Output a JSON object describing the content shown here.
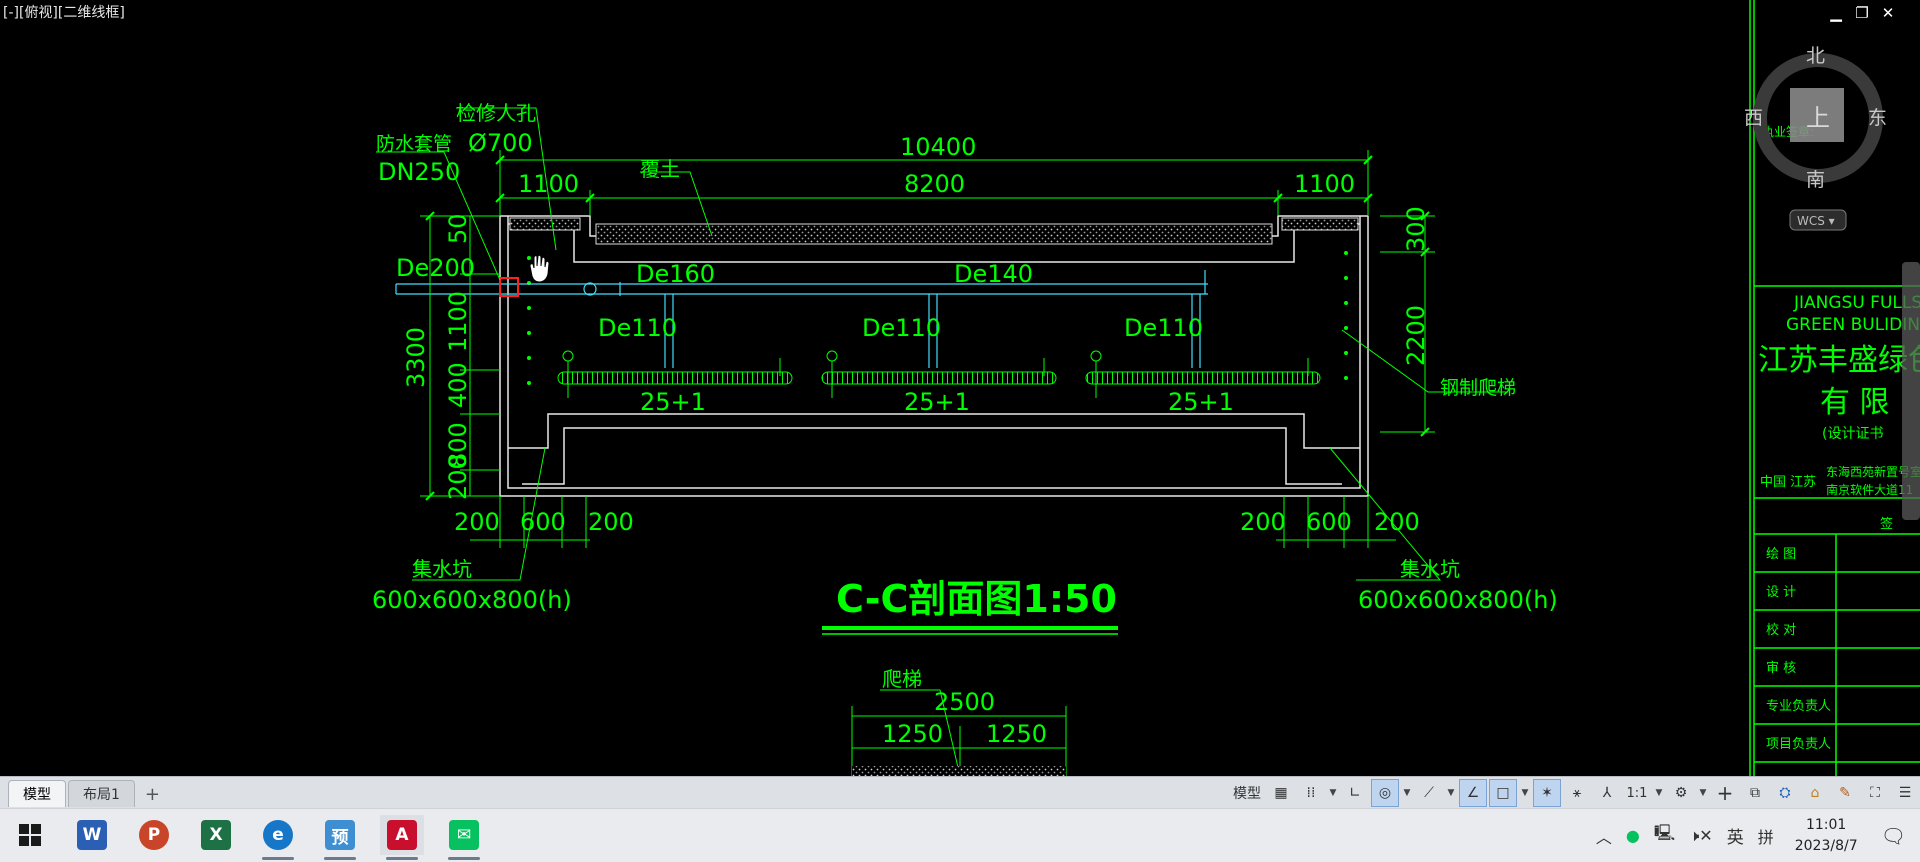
{
  "viewport": {
    "label": "[-][俯视][二维线框]",
    "window_controls": {
      "minimize": "▁",
      "restore": "❐",
      "close": "✕"
    },
    "viewcube": {
      "north": "北",
      "south": "南",
      "east": "东",
      "west": "西",
      "top": "上",
      "wcs": "WCS ▾"
    }
  },
  "drawing": {
    "section_title": "C-C剖面图1:50",
    "dimensions": {
      "overall": "10400",
      "middle": "8200",
      "left_end": "1100",
      "right_end": "1100",
      "h_total": "3300",
      "h_v1": "50",
      "h_v2": "300",
      "h_v3": "1100",
      "h_v4": "400",
      "h_v5": "800",
      "h_v6": "200",
      "right_top": "300",
      "right_mid": "2200",
      "bottom_left": [
        "200",
        "600",
        "200"
      ],
      "bottom_right": [
        "200",
        "600",
        "200"
      ],
      "stair_width": "2500",
      "stair_half_left": "1250",
      "stair_half_right": "1250"
    },
    "labels": {
      "manhole": "检修人孔",
      "manhole_size": "Ø700",
      "sleeve": "防水套管",
      "sleeve_size": "DN250",
      "cover": "覆土",
      "pipe_de200": "De200",
      "pipe_de160": "De160",
      "pipe_de140": "De140",
      "pipe_de110_a": "De110",
      "pipe_de110_b": "De110",
      "pipe_de110_c": "De110",
      "nozzles_a": "25+1",
      "nozzles_b": "25+1",
      "nozzles_c": "25+1",
      "ladder": "钢制爬梯",
      "sump_left": "集水坑",
      "sump_left_size": "600x600x800(h)",
      "sump_right": "集水坑",
      "sump_right_size": "600x600x800(h)",
      "stair": "爬梯"
    }
  },
  "title_block": {
    "company_en_1": "JIANGSU FULLSH",
    "company_en_2": "GREEN BULIDING",
    "company_cn": "江苏丰盛绿色",
    "company_cn_2": "有  限",
    "cert": "(设计证书",
    "stamp": "执业签章:",
    "location": "中国 江苏",
    "address_1": "东海西苑新置号室",
    "address_2": "南京软件大道11",
    "sign": "签",
    "rows": [
      "绘    图",
      "设    计",
      "校    对",
      "审    核",
      "专业负责人",
      "项目负责人"
    ]
  },
  "status_bar": {
    "tabs": [
      "模型",
      "布局1"
    ],
    "add_tab": "+",
    "model_label": "模型",
    "scale": "1:1"
  },
  "taskbar": {
    "apps": [
      {
        "name": "word",
        "glyph": "W",
        "color": "#2b5fb4"
      },
      {
        "name": "powerpoint",
        "glyph": "P",
        "color": "#c8452a"
      },
      {
        "name": "excel",
        "glyph": "X",
        "color": "#1e7145"
      },
      {
        "name": "edge",
        "glyph": "e",
        "color": "#1677c9"
      },
      {
        "name": "preview",
        "glyph": "预",
        "color": "#3d8fd1"
      },
      {
        "name": "autocad",
        "glyph": "A",
        "color": "#c8102e"
      },
      {
        "name": "wechat",
        "glyph": "✉",
        "color": "#07c160"
      }
    ],
    "ime_lang": "英",
    "time": "11:01",
    "date": "2023/8/7"
  }
}
